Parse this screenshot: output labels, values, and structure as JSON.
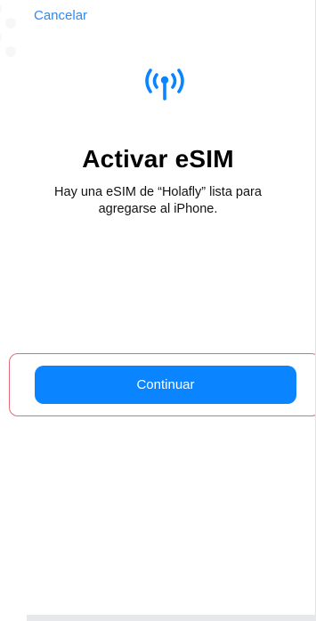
{
  "header": {
    "cancel_label": "Cancelar"
  },
  "icon": {
    "name": "antenna-signal-icon",
    "color": "#0a84ff"
  },
  "main": {
    "title": "Activar eSIM",
    "subtitle": "Hay una eSIM de “Holafly” lista para agregarse al iPhone."
  },
  "actions": {
    "continue_label": "Continuar"
  },
  "colors": {
    "accent": "#0a84ff",
    "link": "#2d8cf0",
    "highlight_border": "#e56b7a"
  }
}
